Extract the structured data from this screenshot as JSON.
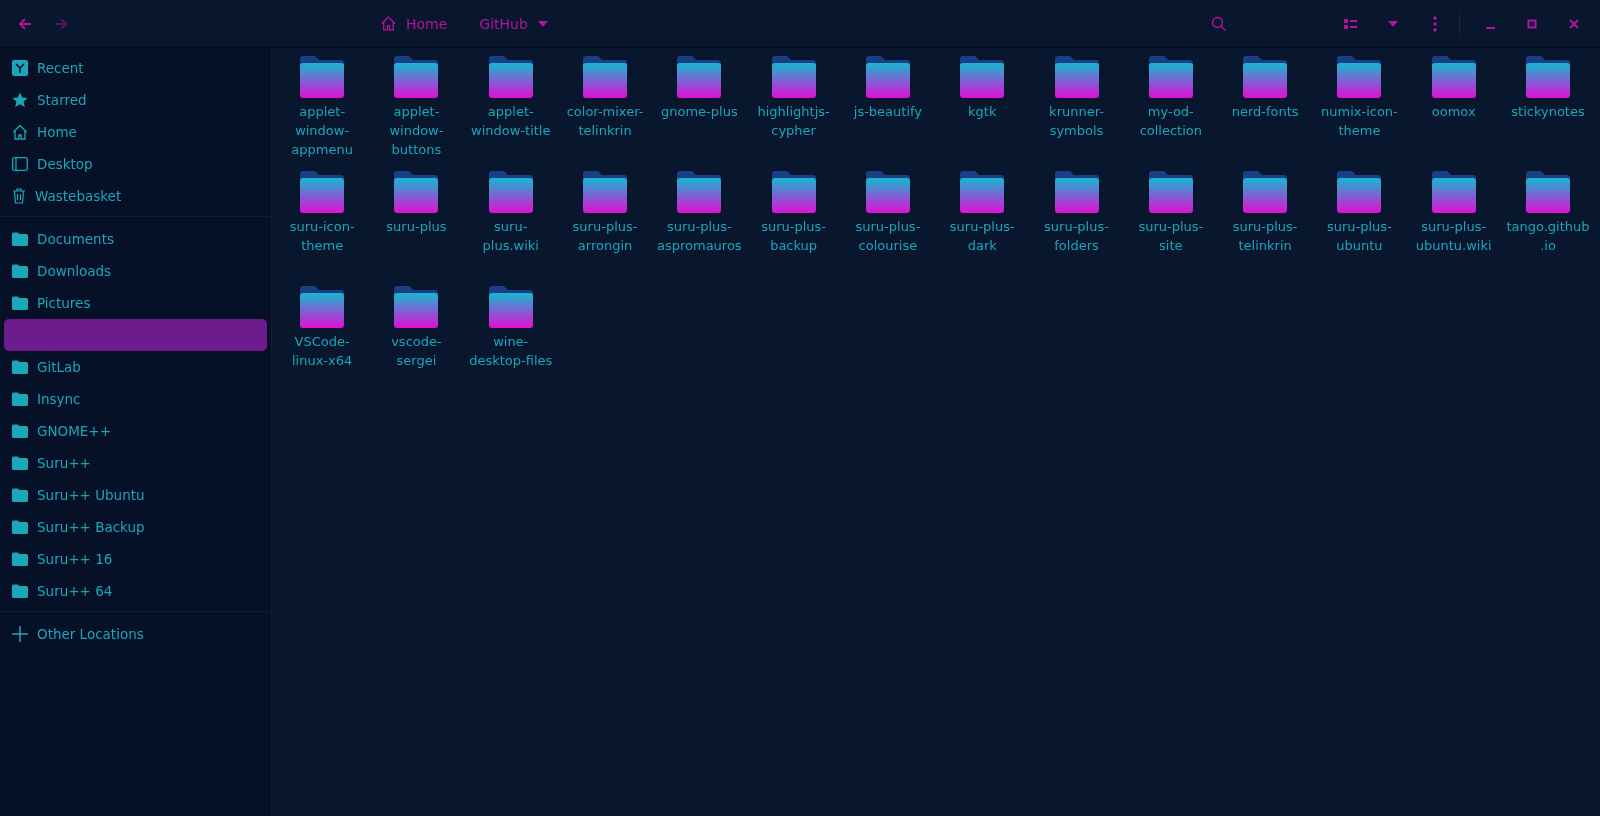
{
  "toolbar": {
    "back_enabled": true,
    "forward_enabled": false,
    "path": [
      {
        "label": "Home",
        "kind": "home"
      },
      {
        "label": "GitHub",
        "kind": "menu"
      }
    ]
  },
  "sidebar": {
    "sections": [
      [
        {
          "label": "Recent",
          "kind": "recent",
          "selected": false
        },
        {
          "label": "Starred",
          "kind": "star",
          "selected": false
        },
        {
          "label": "Home",
          "kind": "home",
          "selected": false
        },
        {
          "label": "Desktop",
          "kind": "desktop",
          "selected": false
        },
        {
          "label": "Wastebasket",
          "kind": "trash",
          "selected": false
        }
      ],
      [
        {
          "label": "Documents",
          "kind": "folder",
          "selected": false
        },
        {
          "label": "Downloads",
          "kind": "folder",
          "selected": false
        },
        {
          "label": "Pictures",
          "kind": "folder",
          "selected": false
        },
        {
          "selected": true
        },
        {
          "label": "GitLab",
          "kind": "folder",
          "selected": false
        },
        {
          "label": "Insync",
          "kind": "folder",
          "selected": false
        },
        {
          "label": "GNOME++",
          "kind": "folder",
          "selected": false
        },
        {
          "label": "Suru++",
          "kind": "folder",
          "selected": false
        },
        {
          "label": "Suru++ Ubuntu",
          "kind": "folder",
          "selected": false
        },
        {
          "label": "Suru++ Backup",
          "kind": "folder",
          "selected": false
        },
        {
          "label": "Suru++ 16",
          "kind": "folder",
          "selected": false
        },
        {
          "label": "Suru++ 64",
          "kind": "folder",
          "selected": false
        }
      ],
      [
        {
          "label": "Other Locations",
          "kind": "plus",
          "selected": false
        }
      ]
    ]
  },
  "files": [
    "applet-window-appmenu",
    "applet-window-buttons",
    "applet-window-title",
    "color-mixer-telinkrin",
    "gnome-plus",
    "highlightjs-cypher",
    "js-beautify",
    "kgtk",
    "krunner-symbols",
    "my-od-collection",
    "nerd-fonts",
    "numix-icon-theme",
    "oomox",
    "stickynotes",
    "suru-icon-theme",
    "suru-plus",
    "suru-plus.wiki",
    "suru-plus-arrongin",
    "suru-plus-aspromauros",
    "suru-plus-backup",
    "suru-plus-colourise",
    "suru-plus-dark",
    "suru-plus-folders",
    "suru-plus-site",
    "suru-plus-telinkrin",
    "suru-plus-ubuntu",
    "suru-plus-ubuntu.wiki",
    "tango.github.io",
    "VSCode-linux-x64",
    "vscode-sergei",
    "wine-desktop-files"
  ]
}
